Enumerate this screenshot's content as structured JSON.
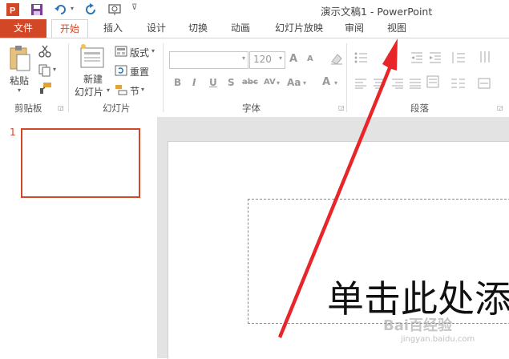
{
  "window": {
    "title": "演示文稿1 - PowerPoint"
  },
  "tabs": [
    {
      "label": "文件"
    },
    {
      "label": "开始"
    },
    {
      "label": "插入"
    },
    {
      "label": "设计"
    },
    {
      "label": "切换"
    },
    {
      "label": "动画"
    },
    {
      "label": "幻灯片放映"
    },
    {
      "label": "审阅"
    },
    {
      "label": "视图"
    }
  ],
  "ribbon": {
    "clipboard": {
      "paste_label": "粘贴",
      "group_label": "剪贴板"
    },
    "slides": {
      "new_slide_line1": "新建",
      "new_slide_line2": "幻灯片",
      "layout_label": "版式",
      "reset_label": "重置",
      "section_label": "节",
      "group_label": "幻灯片"
    },
    "font": {
      "font_name_value": "",
      "font_size_value": "120",
      "group_label": "字体",
      "grow_glyph": "A",
      "shrink_glyph": "A",
      "bold": "B",
      "italic": "I",
      "underline": "U",
      "shadow": "S",
      "strike": "abc",
      "spacing": "AV",
      "case": "Aa",
      "color": "A"
    },
    "paragraph": {
      "group_label": "段落"
    }
  },
  "slides_panel": {
    "slide_number": "1"
  },
  "slide": {
    "placeholder_text": "单击此处添"
  },
  "watermark": {
    "text": "Bai百经验",
    "sub": "jingyan.baidu.com"
  },
  "colors": {
    "accent": "#d24726",
    "arrow": "#e8262a"
  }
}
